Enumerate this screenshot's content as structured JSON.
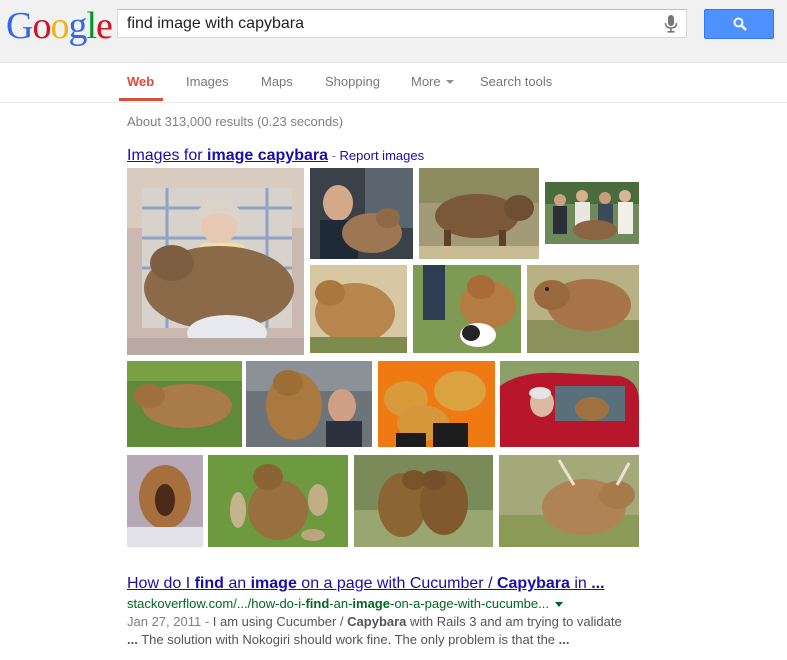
{
  "logo": {
    "letters": [
      "G",
      "o",
      "o",
      "g",
      "l",
      "e"
    ],
    "colors": [
      "#3369e8",
      "#d50f25",
      "#eeb211",
      "#3369e8",
      "#009925",
      "#d50f25"
    ]
  },
  "search": {
    "query": "find image with capybara",
    "button_icon": "magnifier-icon",
    "mic_icon": "microphone-icon"
  },
  "tabs": [
    "Web",
    "Images",
    "Maps",
    "Shopping",
    "More",
    "Search tools"
  ],
  "stats": "About 313,000 results (0.23 seconds)",
  "images_section": {
    "prefix": "Images for ",
    "bold": "image capybara",
    "separator": " - ",
    "report": "Report images",
    "count": 16
  },
  "result": {
    "title": [
      {
        "t": "How do I ",
        "b": false
      },
      {
        "t": "find",
        "b": true
      },
      {
        "t": " an ",
        "b": false
      },
      {
        "t": "image",
        "b": true
      },
      {
        "t": " on a page with Cucumber / ",
        "b": false
      },
      {
        "t": "Capybara",
        "b": true
      },
      {
        "t": " in ",
        "b": false
      },
      {
        "t": "...",
        "b": true
      }
    ],
    "url": [
      {
        "t": "stackoverflow.com/.../how-do-i-",
        "b": false
      },
      {
        "t": "find",
        "b": true
      },
      {
        "t": "-an-",
        "b": false
      },
      {
        "t": "image",
        "b": true
      },
      {
        "t": "-on-a-page-with-cucumbe...",
        "b": false
      }
    ],
    "date": "Jan 27, 2011 - ",
    "snippet_line1": [
      {
        "t": "I am using Cucumber / ",
        "b": false
      },
      {
        "t": "Capybara",
        "b": true
      },
      {
        "t": " with Rails 3 and am trying to validate",
        "b": false
      }
    ],
    "snippet_line2": [
      {
        "t": "...",
        "b": true
      },
      {
        "t": " The solution with Nokogiri should work fine. The only problem is that the ",
        "b": false
      },
      {
        "t": "...",
        "b": true
      }
    ]
  },
  "colors": {
    "link": "#1a0dab",
    "url_green": "#006621",
    "tab_active": "#dd4b39",
    "button_blue": "#4d90fe"
  }
}
